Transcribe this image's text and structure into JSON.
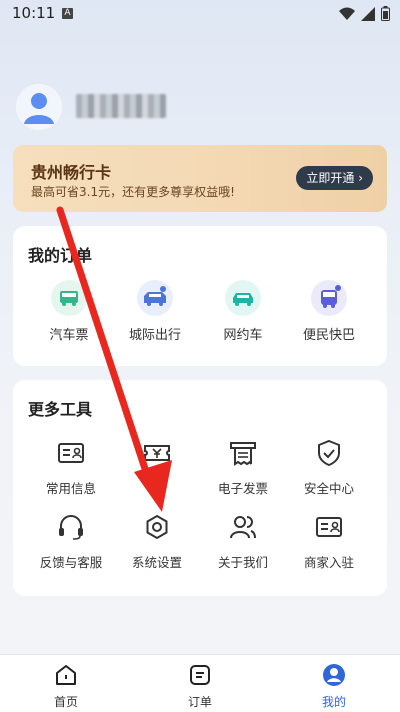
{
  "status_bar": {
    "time": "10:11",
    "badge": "A"
  },
  "profile": {
    "avatar_icon": "user-avatar-icon"
  },
  "vip_card": {
    "title": "贵州畅行卡",
    "subtitle": "最高可省3.1元，还有更多尊享权益哦!",
    "button_label": "立即开通",
    "button_chevron": "›"
  },
  "orders": {
    "title": "我的订单",
    "items": [
      {
        "label": "汽车票",
        "icon": "bus-icon",
        "color": "#35b58a"
      },
      {
        "label": "城际出行",
        "icon": "intercity-icon",
        "color": "#4e74d9"
      },
      {
        "label": "网约车",
        "icon": "car-icon",
        "color": "#1fb3a6"
      },
      {
        "label": "便民快巴",
        "icon": "shuttle-icon",
        "color": "#5a5fd6"
      }
    ]
  },
  "tools": {
    "title": "更多工具",
    "items": [
      {
        "label": "常用信息",
        "icon": "id-card-icon"
      },
      {
        "label": "券",
        "icon": "coupon-icon"
      },
      {
        "label": "电子发票",
        "icon": "invoice-icon"
      },
      {
        "label": "安全中心",
        "icon": "shield-icon"
      },
      {
        "label": "反馈与客服",
        "icon": "headset-icon"
      },
      {
        "label": "系统设置",
        "icon": "settings-icon"
      },
      {
        "label": "关于我们",
        "icon": "people-icon"
      },
      {
        "label": "商家入驻",
        "icon": "merchant-icon"
      }
    ]
  },
  "bottom_nav": {
    "items": [
      {
        "label": "首页",
        "icon": "home-icon",
        "active": false
      },
      {
        "label": "订单",
        "icon": "orders-icon",
        "active": false
      },
      {
        "label": "我的",
        "icon": "profile-icon",
        "active": true
      }
    ]
  },
  "colors": {
    "accent": "#2f66d8",
    "arrow": "#e8271f",
    "vip_text": "#5a3413"
  }
}
